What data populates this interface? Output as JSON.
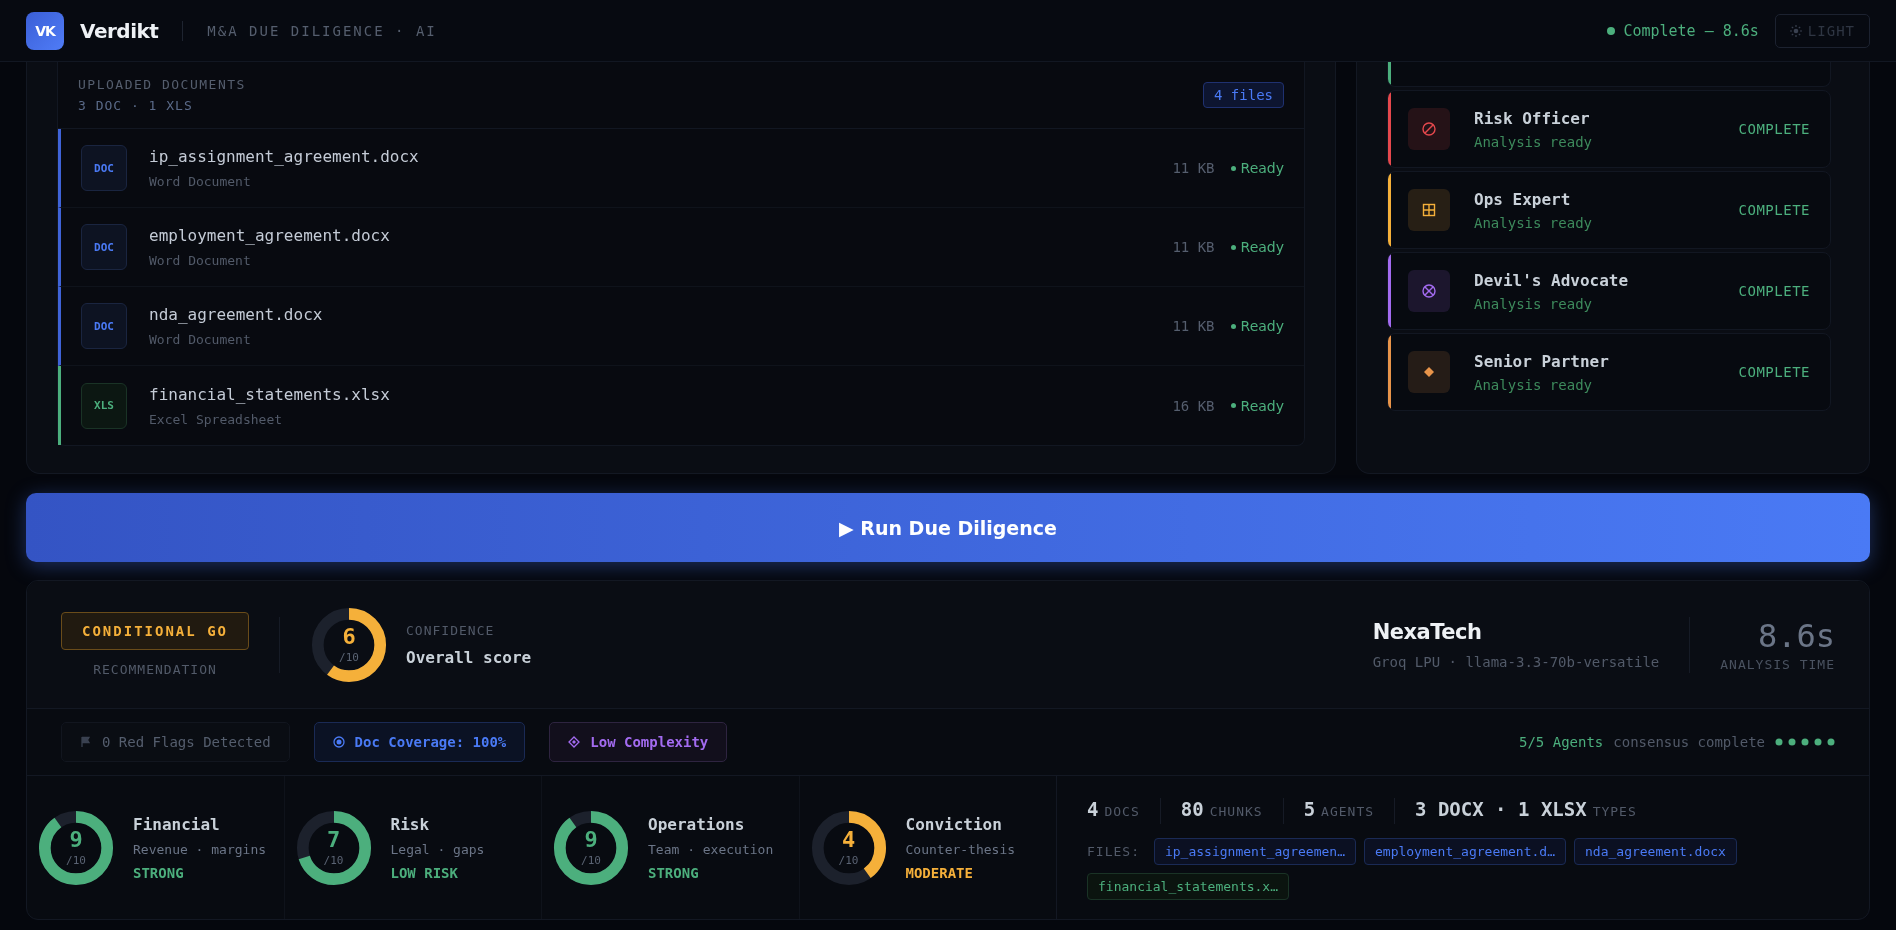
{
  "header": {
    "logo": "VK",
    "brand": "Verdikt",
    "tagline": "M&A DUE DILIGENCE · AI",
    "status": "Complete — 8.6s",
    "theme_button": "LIGHT"
  },
  "documents": {
    "title": "UPLOADED DOCUMENTS",
    "summary": "3 DOC · 1 XLS",
    "count_badge": "4 files",
    "items": [
      {
        "kind": "doc",
        "badge": "DOC",
        "name": "ip_assignment_agreement.docx",
        "type": "Word Document",
        "size": "11 KB",
        "status": "Ready"
      },
      {
        "kind": "doc",
        "badge": "DOC",
        "name": "employment_agreement.docx",
        "type": "Word Document",
        "size": "11 KB",
        "status": "Ready"
      },
      {
        "kind": "doc",
        "badge": "DOC",
        "name": "nda_agreement.docx",
        "type": "Word Document",
        "size": "11 KB",
        "status": "Ready"
      },
      {
        "kind": "xls",
        "badge": "XLS",
        "name": "financial_statements.xlsx",
        "type": "Excel Spreadsheet",
        "size": "16 KB",
        "status": "Ready"
      }
    ]
  },
  "agents": [
    {
      "kind": "partial",
      "color": "#4caf7d"
    },
    {
      "kind": "slash",
      "name": "Risk Officer",
      "note": "Analysis ready",
      "state": "COMPLETE",
      "color": "#e5484d"
    },
    {
      "kind": "grid",
      "name": "Ops Expert",
      "note": "Analysis ready",
      "state": "COMPLETE",
      "color": "#f5b03a"
    },
    {
      "kind": "cross",
      "name": "Devil's Advocate",
      "note": "Analysis ready",
      "state": "COMPLETE",
      "color": "#a36bf0"
    },
    {
      "kind": "diamond",
      "name": "Senior Partner",
      "note": "Analysis ready",
      "state": "COMPLETE",
      "color": "#e8944a"
    }
  ],
  "run_button": "▶ Run Due Diligence",
  "result": {
    "recommendation": "CONDITIONAL GO",
    "recommendation_label": "RECOMMENDATION",
    "confidence": {
      "score": "6",
      "scale": "/10",
      "level": 0.6,
      "label": "CONFIDENCE",
      "caption": "Overall score"
    },
    "company": "NexaTech",
    "engine": "Groq LPU · llama-3.3-70b-versatile",
    "time": "8.6s",
    "time_label": "ANALYSIS TIME",
    "flags": [
      {
        "kind": "flag",
        "text": "0 Red Flags Detected"
      },
      {
        "kind": "coverage",
        "text": "Doc Coverage: 100%"
      },
      {
        "kind": "complexity",
        "text": "Low Complexity"
      }
    ],
    "consensus": {
      "count": "5/5 Agents",
      "text": "consensus complete"
    },
    "scores": [
      {
        "name": "Financial",
        "score": "9",
        "scale": "/10",
        "level": 0.9,
        "subtitle": "Revenue · margins",
        "verdict": "STRONG",
        "color": "#4caf7d"
      },
      {
        "name": "Risk",
        "score": "7",
        "scale": "/10",
        "level": 0.7,
        "subtitle": "Legal · gaps",
        "verdict": "LOW RISK",
        "color": "#4caf7d"
      },
      {
        "name": "Operations",
        "score": "9",
        "scale": "/10",
        "level": 0.9,
        "subtitle": "Team · execution",
        "verdict": "STRONG",
        "color": "#4caf7d"
      },
      {
        "name": "Conviction",
        "score": "4",
        "scale": "/10",
        "level": 0.4,
        "subtitle": "Counter-thesis",
        "verdict": "MODERATE",
        "color": "#f5b03a"
      }
    ],
    "stats": [
      {
        "value": "4",
        "label": "DOCS"
      },
      {
        "value": "80",
        "label": "CHUNKS"
      },
      {
        "value": "5",
        "label": "AGENTS"
      },
      {
        "value": "3 DOCX · 1 XLSX",
        "label": "TYPES"
      }
    ],
    "files_label": "FILES:",
    "file_chips": [
      {
        "kind": "doc",
        "text": "ip_assignment_agreemen…"
      },
      {
        "kind": "doc",
        "text": "employment_agreement.d…"
      },
      {
        "kind": "doc",
        "text": "nda_agreement.docx"
      },
      {
        "kind": "xls",
        "text": "financial_statements.x…"
      }
    ]
  }
}
